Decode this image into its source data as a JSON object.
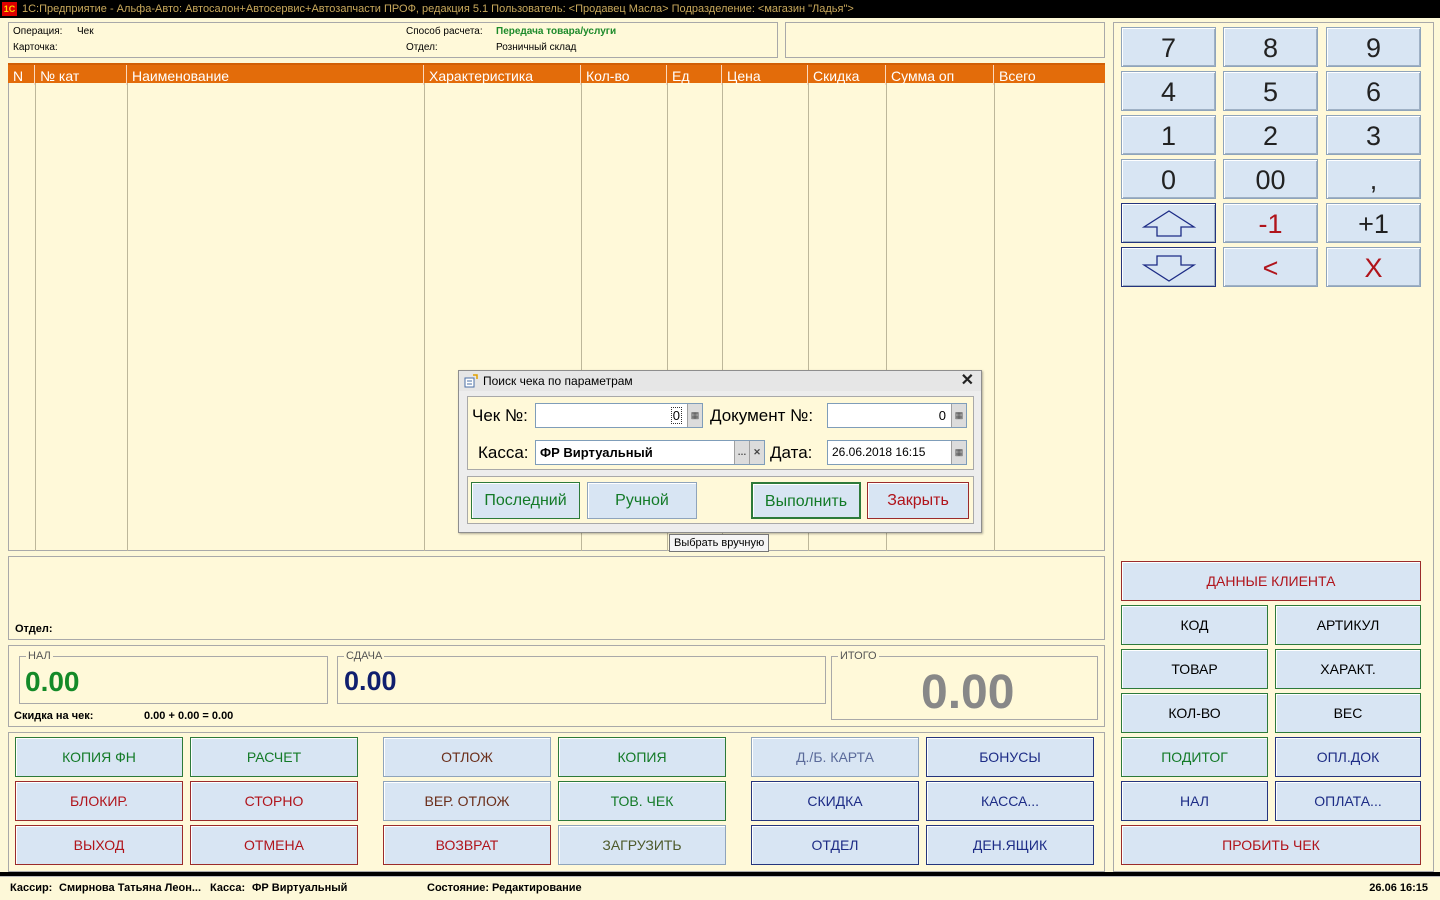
{
  "window": {
    "title": "1С:Предприятие - Альфа-Авто: Автосалон+Автосервис+Автозапчасти ПРОФ, редакция 5.1     Пользователь: <Продавец Масла>     Подразделение: <магазин \"Ладья\">",
    "icon_text": "1С"
  },
  "header": {
    "operation_label": "Операция:",
    "operation_value": "Чек",
    "card_label": "Карточка:",
    "payment_method_label": "Способ расчета:",
    "payment_method_value": "Передача товара/услуги",
    "department_label": "Отдел:",
    "department_value": "Розничный склад"
  },
  "table": {
    "columns": [
      "N",
      "№ кат",
      "Наименование",
      "Характеристика",
      "Кол-во",
      "Ед",
      "Цена",
      "Скидка",
      "Сумма оп",
      "Всего"
    ]
  },
  "info": {
    "department_label": "Отдел:"
  },
  "totals": {
    "cash_label": "НАЛ",
    "cash_value": "0.00",
    "change_label": "СДАЧА",
    "change_value": "0.00",
    "total_label": "ИТОГО",
    "total_value": "0.00",
    "discount_label": "Скидка на чек:",
    "discount_value": "0.00 + 0.00 = 0.00"
  },
  "keypad": {
    "keys": [
      "7",
      "8",
      "9",
      "4",
      "5",
      "6",
      "1",
      "2",
      "3",
      "0",
      "00",
      ",",
      "",
      "-1",
      "+1",
      "",
      "<",
      "X"
    ]
  },
  "right_buttons": {
    "client_data": "ДАННЫЕ КЛИЕНТА",
    "code": "КОД",
    "article": "АРТИКУЛ",
    "product": "ТОВАР",
    "charact": "ХАРАКТ.",
    "quantity": "КОЛ-ВО",
    "weight": "ВЕС",
    "subtotal": "ПОДИТОГ",
    "pay_doc": "ОПЛ.ДОК",
    "cash": "НАЛ",
    "payment": "ОПЛАТА...",
    "print_check": "ПРОБИТЬ ЧЕК"
  },
  "bottom_buttons": {
    "copy_fn": "КОПИЯ ФН",
    "calc": "РАСЧЕТ",
    "postpone": "ОТЛОЖ",
    "copy": "КОПИЯ",
    "discount_card": "Д./Б. КАРТА",
    "bonuses": "БОНУСЫ",
    "block": "БЛОКИР.",
    "storno": "СТОРНО",
    "return_postponed": "ВЕР. ОТЛОЖ",
    "goods_check": "ТОВ. ЧЕК",
    "discount": "СКИДКА",
    "cashbox": "КАССА...",
    "exit": "ВЫХОД",
    "cancel": "ОТМЕНА",
    "refund": "ВОЗВРАТ",
    "load": "ЗАГРУЗИТЬ",
    "department": "ОТДЕЛ",
    "cash_drawer": "ДЕН.ЯЩИК"
  },
  "dialog": {
    "title": "Поиск чека по параметрам",
    "check_no_label": "Чек №:",
    "check_no_value": "0",
    "document_no_label": "Документ №:",
    "document_no_value": "0",
    "register_label": "Касса:",
    "register_value": "ФР Виртуальный",
    "date_label": "Дата:",
    "date_value": "26.06.2018 16:15",
    "last_button": "Последний",
    "manual_button": "Ручной",
    "execute_button": "Выполнить",
    "close_button": "Закрыть"
  },
  "tooltip": "Выбрать вручную",
  "status": {
    "cashier_label": "Кассир:",
    "cashier_value": "Смирнова Татьяна Леон...",
    "register_label": "Касса:",
    "register_value": "ФР Виртуальный",
    "state_label": "Состояние:",
    "state_value": "Редактирование",
    "datetime": "26.06 16:15"
  }
}
